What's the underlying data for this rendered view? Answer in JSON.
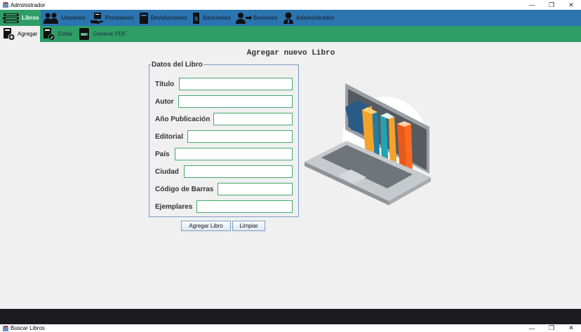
{
  "window": {
    "title": "Administrador",
    "minimize": "—",
    "maximize": "❐",
    "close": "✕"
  },
  "menu": [
    {
      "label": "Libros",
      "icon": "books-icon"
    },
    {
      "label": "Usuarios",
      "icon": "users-icon"
    },
    {
      "label": "Prestamos",
      "icon": "loan-icon"
    },
    {
      "label": "Devoluciones",
      "icon": "return-book-icon"
    },
    {
      "label": "Sanciones",
      "icon": "sanction-icon"
    },
    {
      "label": "Sesiones",
      "icon": "session-icon"
    },
    {
      "label": "Administrador",
      "icon": "admin-icon"
    }
  ],
  "submenu": [
    {
      "label": "Agregar",
      "icon": "add-book-icon"
    },
    {
      "label": "Editar",
      "icon": "edit-book-icon"
    },
    {
      "label": "Generar PDF",
      "icon": "pdf-icon"
    }
  ],
  "page_title": "Agregar nuevo Libro",
  "form": {
    "legend": "Datos del Libro",
    "fields": [
      {
        "label": "Título",
        "value": ""
      },
      {
        "label": "Autor",
        "value": ""
      },
      {
        "label": "Año Publicación",
        "value": ""
      },
      {
        "label": "Editorial",
        "value": ""
      },
      {
        "label": "País",
        "value": ""
      },
      {
        "label": "Ciudad",
        "value": ""
      },
      {
        "label": "Código de Barras",
        "value": ""
      },
      {
        "label": "Ejemplares",
        "value": ""
      }
    ]
  },
  "buttons": {
    "add": "Agregar Libro",
    "clear": "Limpiar"
  },
  "bottom_window": {
    "title": "Buscar Libros",
    "minimize": "—",
    "maximize": "❐",
    "close": "✕"
  },
  "colors": {
    "menubar": "#2a74b0",
    "submenu": "#2e9e66",
    "input_border": "#44a86b"
  }
}
